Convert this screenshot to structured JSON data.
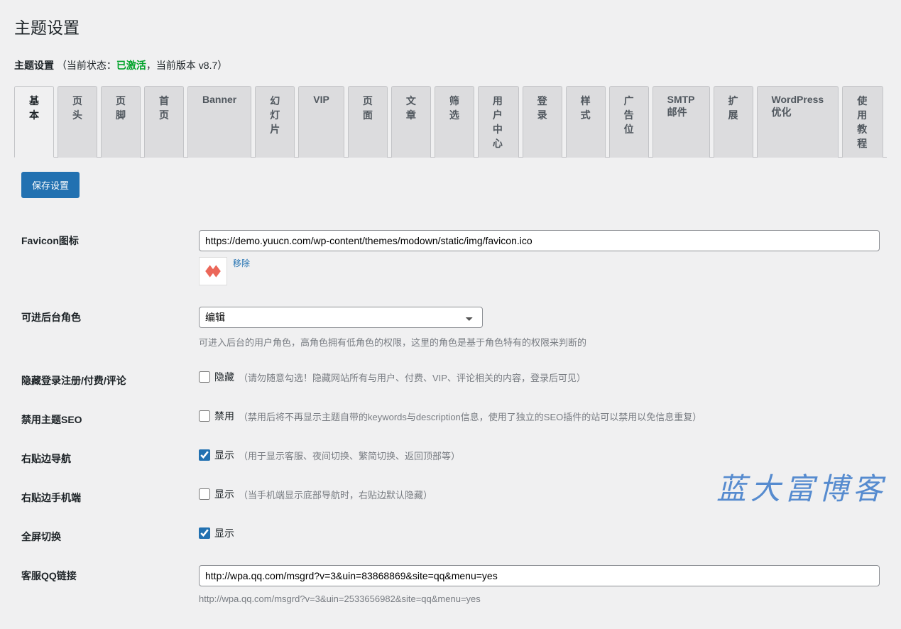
{
  "page_title": "主题设置",
  "subtitle": {
    "label": "主题设置",
    "status_prefix": "（当前状态：",
    "status_value": "已激活",
    "version_text": "，当前版本 v8.7）"
  },
  "tabs": [
    "基本",
    "页头",
    "页脚",
    "首页",
    "Banner",
    "幻灯片",
    "VIP",
    "页面",
    "文章",
    "筛选",
    "用户中心",
    "登录",
    "样式",
    "广告位",
    "SMTP邮件",
    "扩展",
    "WordPress优化",
    "使用教程"
  ],
  "active_tab_index": 0,
  "save_button": "保存设置",
  "fields": {
    "favicon": {
      "label": "Favicon图标",
      "value": "https://demo.yuucn.com/wp-content/themes/modown/static/img/favicon.ico",
      "remove": "移除"
    },
    "backend_role": {
      "label": "可进后台角色",
      "selected": "编辑",
      "desc": "可进入后台的用户角色，高角色拥有低角色的权限，这里的角色是基于角色特有的权限来判断的"
    },
    "hide_login": {
      "label": "隐藏登录注册/付费/评论",
      "checkbox_label": "隐藏",
      "hint": "（请勿随意勾选！隐藏网站所有与用户、付费、VIP、评论相关的内容，登录后可见）",
      "checked": false
    },
    "disable_seo": {
      "label": "禁用主题SEO",
      "checkbox_label": "禁用",
      "hint": "（禁用后将不再显示主题自带的keywords与description信息，使用了独立的SEO插件的站可以禁用以免信息重复）",
      "checked": false
    },
    "right_nav": {
      "label": "右贴边导航",
      "checkbox_label": "显示",
      "hint": "（用于显示客服、夜间切换、繁简切换、返回顶部等）",
      "checked": true
    },
    "right_nav_mobile": {
      "label": "右贴边手机端",
      "checkbox_label": "显示",
      "hint": "（当手机端显示底部导航时，右贴边默认隐藏）",
      "checked": false
    },
    "fullscreen": {
      "label": "全屏切换",
      "checkbox_label": "显示",
      "hint": "",
      "checked": true
    },
    "qq_link": {
      "label": "客服QQ链接",
      "value": "http://wpa.qq.com/msgrd?v=3&uin=83868869&site=qq&menu=yes",
      "desc": "http://wpa.qq.com/msgrd?v=3&uin=2533656982&site=qq&menu=yes"
    }
  },
  "watermark": "蓝大富博客"
}
